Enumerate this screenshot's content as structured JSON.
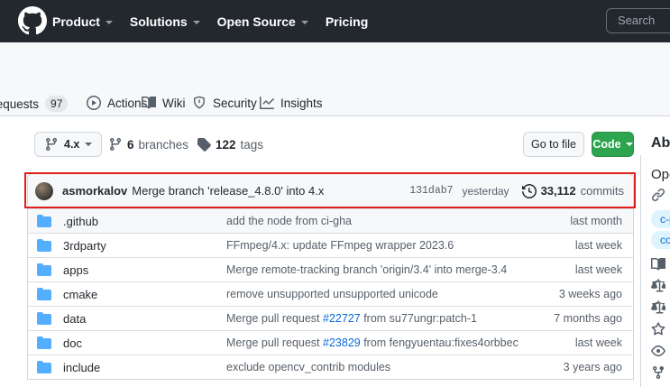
{
  "header": {
    "nav": [
      {
        "label": "Product"
      },
      {
        "label": "Solutions"
      },
      {
        "label": "Open Source"
      },
      {
        "label": "Pricing"
      }
    ],
    "search_placeholder": "Search"
  },
  "tabs": [
    {
      "label": "Pull requests",
      "count": "97"
    },
    {
      "label": "Actions"
    },
    {
      "label": "Wiki"
    },
    {
      "label": "Security"
    },
    {
      "label": "Insights"
    }
  ],
  "toolbar": {
    "branch": "4.x",
    "branches_count": "6",
    "branches_label": "branches",
    "tags_count": "122",
    "tags_label": "tags",
    "go_to_file_label": "Go to file",
    "code_label": "Code"
  },
  "commit": {
    "author": "asmorkalov",
    "message": "Merge branch 'release_4.8.0' into 4.x",
    "sha": "131dab7",
    "time": "yesterday",
    "commits_count": "33,112",
    "commits_label": "commits"
  },
  "files": {
    "rows": [
      {
        "name": ".github",
        "msg_pre": "add the node from ci-gha",
        "msg_link": "",
        "msg_post": "",
        "date": "last month"
      },
      {
        "name": "3rdparty",
        "msg_pre": "FFmpeg/4.x: update FFmpeg wrapper 2023.6",
        "msg_link": "",
        "msg_post": "",
        "date": "last week"
      },
      {
        "name": "apps",
        "msg_pre": "Merge remote-tracking branch 'origin/3.4' into merge-3.4",
        "msg_link": "",
        "msg_post": "",
        "date": "last week"
      },
      {
        "name": "cmake",
        "msg_pre": "remove unsupported unsupported unicode",
        "msg_link": "",
        "msg_post": "",
        "date": "3 weeks ago"
      },
      {
        "name": "data",
        "msg_pre": "Merge pull request ",
        "msg_link": "#22727",
        "msg_post": " from su77ungr:patch-1",
        "date": "7 months ago"
      },
      {
        "name": "doc",
        "msg_pre": "Merge pull request ",
        "msg_link": "#23829",
        "msg_post": " from fengyuentau:fixes4orbbec",
        "date": "last week"
      },
      {
        "name": "include",
        "msg_pre": "exclude opencv_contrib modules",
        "msg_link": "",
        "msg_post": "",
        "date": "3 years ago"
      }
    ]
  },
  "sidebar": {
    "title": "About",
    "description": "Open Source Computer Vision Library",
    "topics": [
      "c-plus-plus",
      "computer-vision"
    ]
  },
  "colors": {
    "header_bg": "#23282e",
    "accent_green": "#2da44e",
    "link_blue": "#0969da",
    "folder_blue": "#54aeff",
    "annotation_red": "#e01e1e",
    "muted_text": "#57606a"
  }
}
